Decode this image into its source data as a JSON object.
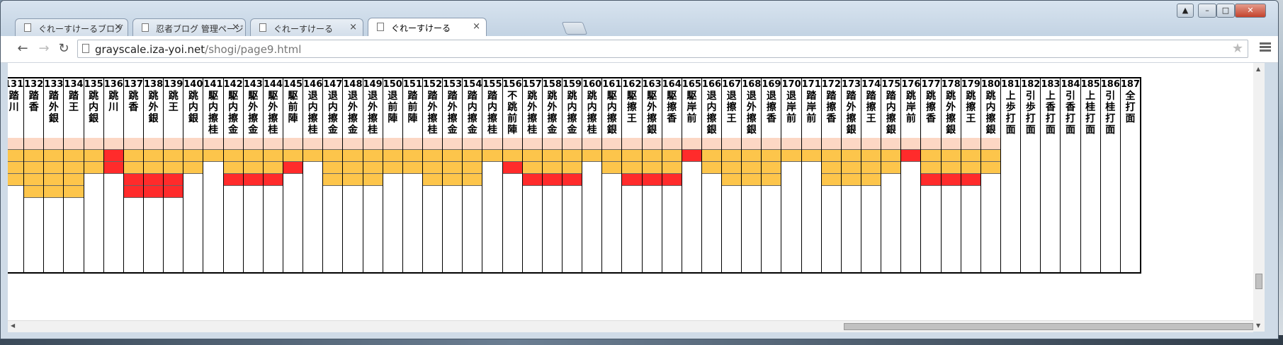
{
  "browser": {
    "tabs": [
      {
        "label": "ぐれーすけーるブログ",
        "active": false
      },
      {
        "label": "忍者ブログ 管理ページ -",
        "active": false
      },
      {
        "label": "ぐれーすけーる",
        "active": false
      },
      {
        "label": "ぐれーすけーる",
        "active": true
      }
    ],
    "url_host": "grayscale.iza-yoi.net",
    "url_path": "/shogi/page9.html",
    "icons": {
      "back": "back-arrow-icon",
      "forward": "forward-arrow-icon",
      "reload": "reload-icon",
      "star": "bookmark-star-icon",
      "menu": "menu-icon"
    },
    "window_controls": {
      "restore_user": "▲",
      "minimize": "–",
      "maximize": "□",
      "close": "✕"
    },
    "tab_close": "×",
    "nav_glyphs": {
      "back": "←",
      "forward": "→",
      "reload": "↻",
      "star": "★"
    }
  },
  "colors": {
    "pink": "#fcd7c4",
    "orange": "#fdc54b",
    "red": "#ff2b2b"
  },
  "moves": [
    {
      "num": "131",
      "name": "踏川",
      "bars": "pooo"
    },
    {
      "num": "132",
      "name": "踏香",
      "bars": "poooo"
    },
    {
      "num": "133",
      "name": "踏外銀",
      "bars": "poooo"
    },
    {
      "num": "134",
      "name": "踏王",
      "bars": "poooo"
    },
    {
      "num": "135",
      "name": "跳内銀",
      "bars": "poo"
    },
    {
      "num": "136",
      "name": "跳川",
      "bars": "prr"
    },
    {
      "num": "137",
      "name": "跳香",
      "bars": "poorr"
    },
    {
      "num": "138",
      "name": "跳外銀",
      "bars": "poorr"
    },
    {
      "num": "139",
      "name": "跳王",
      "bars": "poorr"
    },
    {
      "num": "140",
      "name": "跳内銀",
      "bars": "poo"
    },
    {
      "num": "141",
      "name": "駆内擦桂",
      "bars": "po"
    },
    {
      "num": "142",
      "name": "駆内擦金",
      "bars": "poor"
    },
    {
      "num": "143",
      "name": "駆外擦金",
      "bars": "poor"
    },
    {
      "num": "144",
      "name": "駆外擦桂",
      "bars": "poor"
    },
    {
      "num": "145",
      "name": "駆前陣",
      "bars": "por"
    },
    {
      "num": "146",
      "name": "退内擦桂",
      "bars": "po"
    },
    {
      "num": "147",
      "name": "退内擦金",
      "bars": "pooo"
    },
    {
      "num": "148",
      "name": "退外擦金",
      "bars": "pooo"
    },
    {
      "num": "149",
      "name": "退外擦桂",
      "bars": "pooo"
    },
    {
      "num": "150",
      "name": "退前陣",
      "bars": "poo"
    },
    {
      "num": "151",
      "name": "踏前陣",
      "bars": "poo"
    },
    {
      "num": "152",
      "name": "踏外擦桂",
      "bars": "pooo"
    },
    {
      "num": "153",
      "name": "踏外擦金",
      "bars": "pooo"
    },
    {
      "num": "154",
      "name": "踏内擦金",
      "bars": "pooo"
    },
    {
      "num": "155",
      "name": "踏内擦桂",
      "bars": "po"
    },
    {
      "num": "156",
      "name": "不跳前陣",
      "bars": "por"
    },
    {
      "num": "157",
      "name": "跳外擦桂",
      "bars": "poor"
    },
    {
      "num": "158",
      "name": "跳外擦金",
      "bars": "poor"
    },
    {
      "num": "159",
      "name": "跳内擦金",
      "bars": "poor"
    },
    {
      "num": "160",
      "name": "跳内擦桂",
      "bars": "po"
    },
    {
      "num": "161",
      "name": "駆内擦銀",
      "bars": "poo"
    },
    {
      "num": "162",
      "name": "駆擦王",
      "bars": "poor"
    },
    {
      "num": "163",
      "name": "駆外擦銀",
      "bars": "poor"
    },
    {
      "num": "164",
      "name": "駆擦香",
      "bars": "poor"
    },
    {
      "num": "165",
      "name": "駆岸前",
      "bars": "pr"
    },
    {
      "num": "166",
      "name": "退内擦銀",
      "bars": "poo"
    },
    {
      "num": "167",
      "name": "退擦王",
      "bars": "pooo"
    },
    {
      "num": "168",
      "name": "退外擦銀",
      "bars": "pooo"
    },
    {
      "num": "169",
      "name": "退擦香",
      "bars": "pooo"
    },
    {
      "num": "170",
      "name": "退岸前",
      "bars": "po"
    },
    {
      "num": "171",
      "name": "踏岸前",
      "bars": "po"
    },
    {
      "num": "172",
      "name": "踏擦香",
      "bars": "pooo"
    },
    {
      "num": "173",
      "name": "踏外擦銀",
      "bars": "pooo"
    },
    {
      "num": "174",
      "name": "踏擦王",
      "bars": "pooo"
    },
    {
      "num": "175",
      "name": "踏内擦銀",
      "bars": "poo"
    },
    {
      "num": "176",
      "name": "跳岸前",
      "bars": "pr"
    },
    {
      "num": "177",
      "name": "跳擦香",
      "bars": "poor"
    },
    {
      "num": "178",
      "name": "跳外擦銀",
      "bars": "poor"
    },
    {
      "num": "179",
      "name": "跳擦王",
      "bars": "poor"
    },
    {
      "num": "180",
      "name": "跳内擦銀",
      "bars": "poo"
    },
    {
      "num": "181",
      "name": "上歩打面",
      "bars": ""
    },
    {
      "num": "182",
      "name": "引歩打面",
      "bars": ""
    },
    {
      "num": "183",
      "name": "上香打面",
      "bars": ""
    },
    {
      "num": "184",
      "name": "引香打面",
      "bars": ""
    },
    {
      "num": "185",
      "name": "上桂打面",
      "bars": ""
    },
    {
      "num": "186",
      "name": "引桂打面",
      "bars": ""
    },
    {
      "num": "187",
      "name": "全打面",
      "bars": ""
    }
  ]
}
